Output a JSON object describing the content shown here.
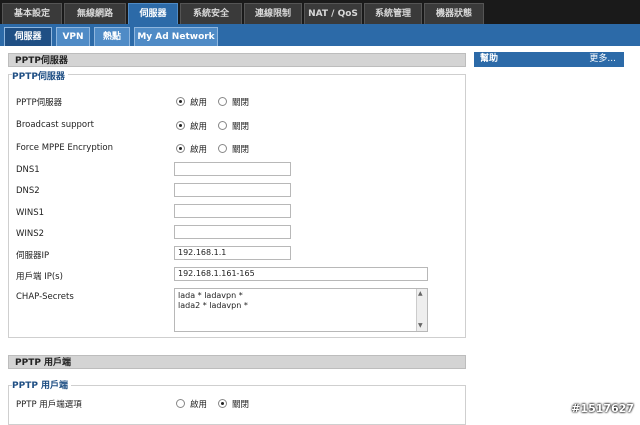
{
  "main_tabs": [
    {
      "label": "基本設定"
    },
    {
      "label": "無線網路"
    },
    {
      "label": "伺服器"
    },
    {
      "label": "系統安全"
    },
    {
      "label": "連線限制"
    },
    {
      "label": "NAT / QoS"
    },
    {
      "label": "系統管理"
    },
    {
      "label": "機器狀態"
    }
  ],
  "sub_tabs": [
    {
      "label": "伺服器"
    },
    {
      "label": "VPN"
    },
    {
      "label": "熱點"
    },
    {
      "label": "My Ad Network"
    }
  ],
  "pptp_server": {
    "header": "PPTP伺服器",
    "legend": "PPTP伺服器",
    "rows": {
      "server": {
        "label": "PPTP伺服器",
        "on": "啟用",
        "off": "關閉",
        "selected": "on"
      },
      "broadcast": {
        "label": "Broadcast support",
        "on": "啟用",
        "off": "關閉",
        "selected": "on"
      },
      "mppe": {
        "label": "Force MPPE Encryption",
        "on": "啟用",
        "off": "關閉",
        "selected": "on"
      }
    },
    "fields": {
      "dns1": {
        "label": "DNS1",
        "value": ""
      },
      "dns2": {
        "label": "DNS2",
        "value": ""
      },
      "wins1": {
        "label": "WINS1",
        "value": ""
      },
      "wins2": {
        "label": "WINS2",
        "value": ""
      },
      "server_ip": {
        "label": "伺服器IP",
        "value": "192.168.1.1"
      },
      "client_ip": {
        "label": "用戶端 IP(s)",
        "value": "192.168.1.161-165"
      }
    },
    "chap": {
      "label": "CHAP-Secrets",
      "lines": [
        "lada * ladavpn *",
        "lada2 * ladavpn *"
      ]
    }
  },
  "pptp_client": {
    "header": "PPTP 用戶端",
    "legend": "PPTP 用戶端",
    "option": {
      "label": "PPTP 用戶端選項",
      "on": "啟用",
      "off": "關閉",
      "selected": "off"
    }
  },
  "help": {
    "title": "幫助",
    "more": "更多..."
  },
  "watermark": "#1517627",
  "colors": {
    "accent": "#2c6aa8",
    "dark": "#1a1a1a",
    "section": "#d4d4d4"
  }
}
